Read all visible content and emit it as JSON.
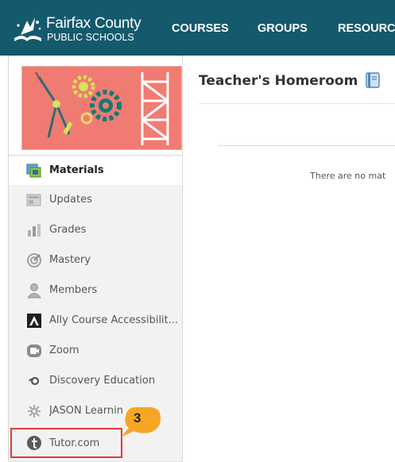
{
  "header": {
    "logo_name": "Fairfax County",
    "logo_sub": "PUBLIC SCHOOLS",
    "nav": [
      "COURSES",
      "GROUPS",
      "RESOURC"
    ]
  },
  "sidebar": {
    "items": [
      {
        "label": "Materials",
        "icon": "materials-icon",
        "active": true
      },
      {
        "label": "Updates",
        "icon": "updates-icon"
      },
      {
        "label": "Grades",
        "icon": "grades-icon"
      },
      {
        "label": "Mastery",
        "icon": "mastery-icon"
      },
      {
        "label": "Members",
        "icon": "members-icon"
      },
      {
        "label": "Ally Course Accessibilit...",
        "icon": "ally-icon"
      },
      {
        "label": "Zoom",
        "icon": "zoom-icon"
      },
      {
        "label": "Discovery Education",
        "icon": "discovery-icon"
      },
      {
        "label": "JASON Learnin",
        "icon": "jason-icon"
      },
      {
        "label": "Tutor.com",
        "icon": "tutor-icon"
      }
    ]
  },
  "main": {
    "title": "Teacher's Homeroom",
    "empty_message": "There are no mat"
  },
  "annotation": {
    "step_number": "3",
    "highlight_color": "#e03b3b",
    "callout_color": "#f5a623"
  },
  "colors": {
    "header_bg": "#14596c",
    "banner_bg": "#f07b72"
  }
}
